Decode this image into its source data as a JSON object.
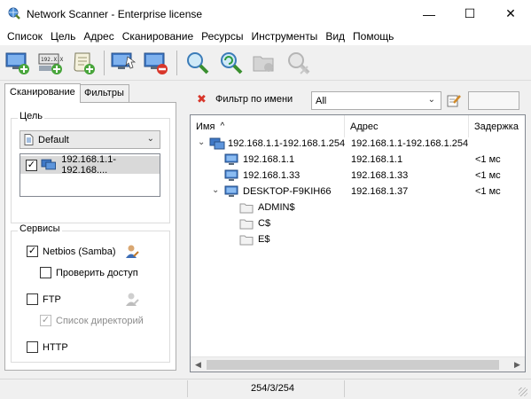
{
  "window": {
    "title": "Network Scanner - Enterprise license",
    "minimize": "—",
    "maximize": "☐",
    "close": "✕"
  },
  "menu": [
    "Список",
    "Цель",
    "Адрес",
    "Сканирование",
    "Ресурсы",
    "Инструменты",
    "Вид",
    "Помощь"
  ],
  "toolbar_icons": [
    "add-computer-icon",
    "add-range-icon",
    "scan-script-icon",
    "scan-icon",
    "stop-scan-icon",
    "find-icon",
    "refresh-icon",
    "share-folder-icon",
    "remove-icon"
  ],
  "left": {
    "tabs": [
      "Сканирование",
      "Фильтры"
    ],
    "target_group": "Цель",
    "target_select": "Default",
    "target_item": "192.168.1.1-192.168....",
    "services_group": "Сервисы",
    "services": [
      {
        "label": "Netbios (Samba)",
        "checked": true,
        "disabled": false
      },
      {
        "label": "Проверить доступ",
        "checked": false,
        "disabled": false
      },
      {
        "label": "FTP",
        "checked": false,
        "disabled": false
      },
      {
        "label": "Список директорий",
        "checked": true,
        "disabled": true
      },
      {
        "label": "HTTP",
        "checked": false,
        "disabled": false
      }
    ]
  },
  "filter": {
    "label": "Фильтр по имени",
    "select_value": "All",
    "text_value": ""
  },
  "tree": {
    "columns": [
      "Имя",
      "Адрес",
      "Задержка"
    ],
    "sort_indicator": "^",
    "rows": [
      {
        "name": "192.168.1.1-192.168.1.254",
        "address": "192.168.1.1-192.168.1.254",
        "delay": "",
        "icon": "network-range-icon",
        "level": 0,
        "expanded": true
      },
      {
        "name": "192.168.1.1",
        "address": "192.168.1.1",
        "delay": "<1 мс",
        "icon": "computer-icon",
        "level": 1,
        "expanded": false
      },
      {
        "name": "192.168.1.33",
        "address": "192.168.1.33",
        "delay": "<1 мс",
        "icon": "computer-icon",
        "level": 1,
        "expanded": false
      },
      {
        "name": "DESKTOP-F9KIH66",
        "address": "192.168.1.37",
        "delay": "<1 мс",
        "icon": "computer-icon",
        "level": 1,
        "expanded": true
      },
      {
        "name": "ADMIN$",
        "address": "",
        "delay": "",
        "icon": "folder-icon",
        "level": 2,
        "expanded": false
      },
      {
        "name": "C$",
        "address": "",
        "delay": "",
        "icon": "folder-icon",
        "level": 2,
        "expanded": false
      },
      {
        "name": "E$",
        "address": "",
        "delay": "",
        "icon": "folder-icon",
        "level": 2,
        "expanded": false
      }
    ]
  },
  "status": {
    "text": "254/3/254"
  }
}
